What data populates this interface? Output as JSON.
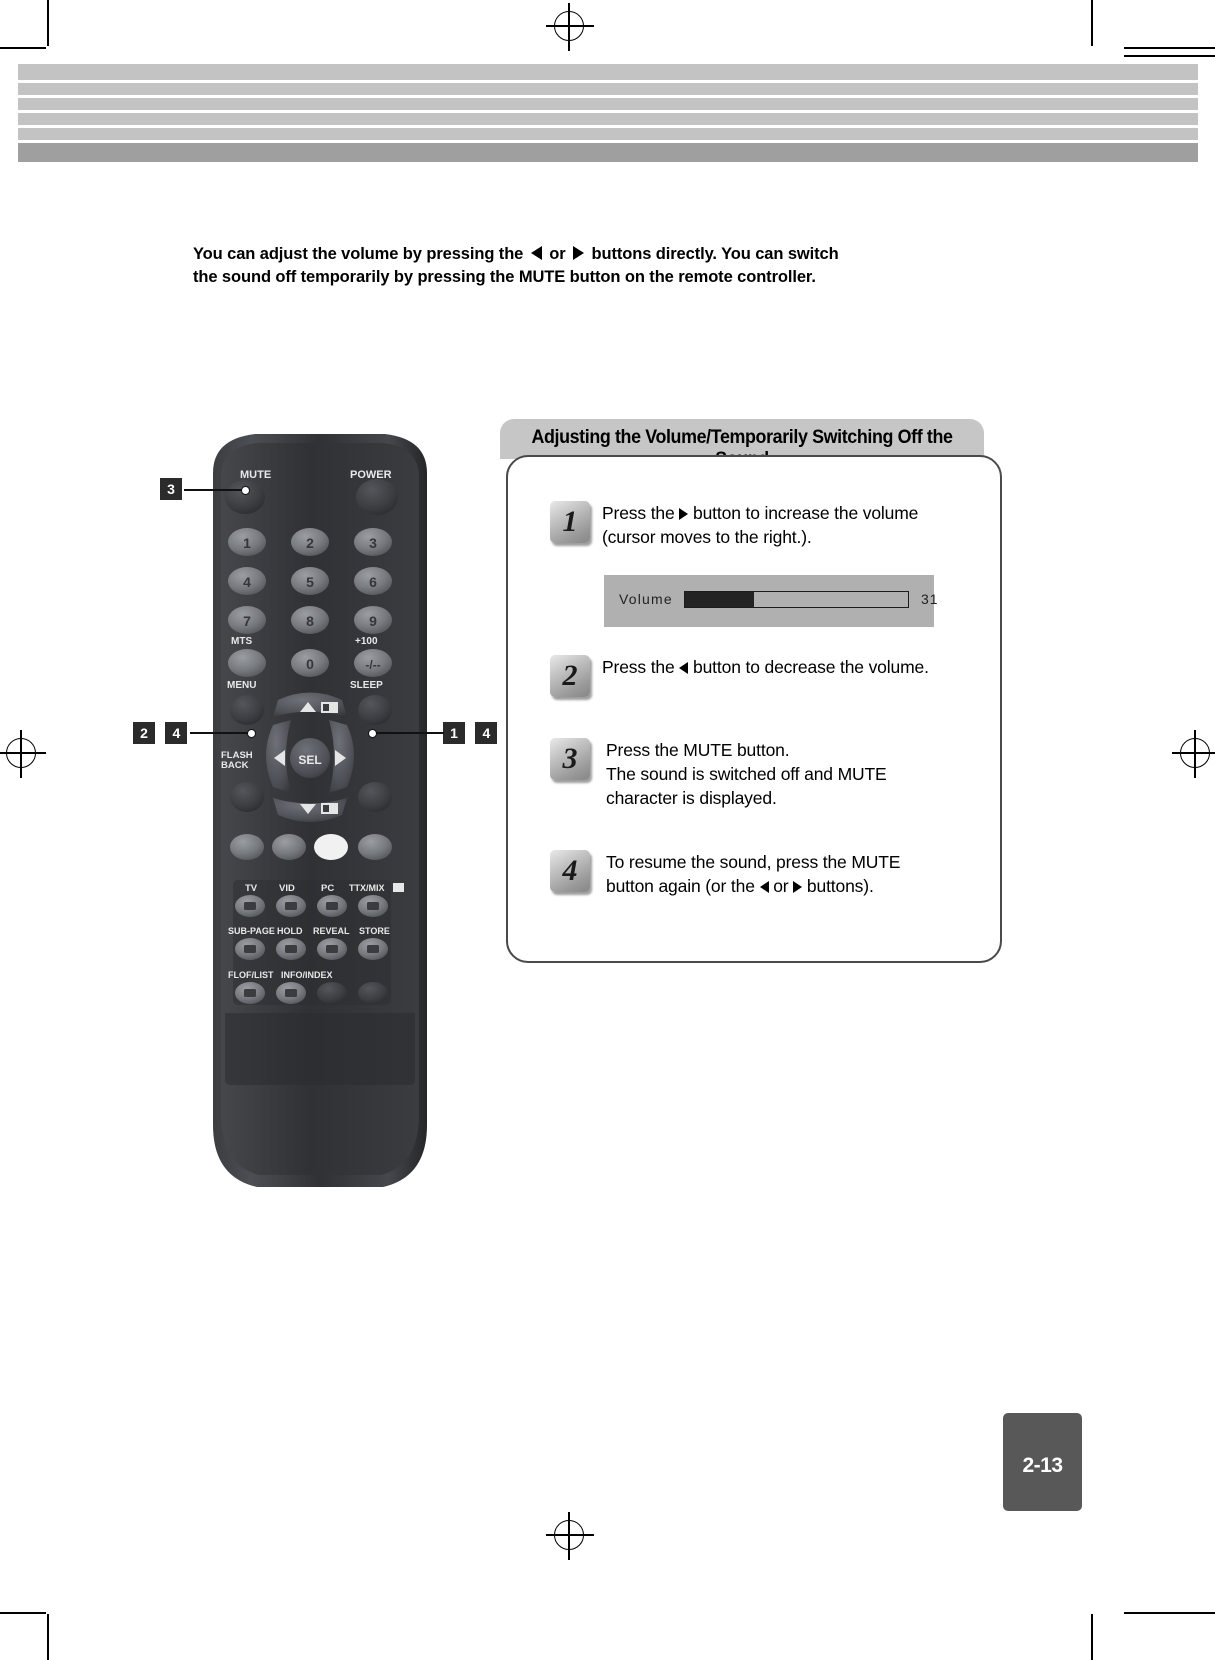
{
  "page": {
    "number": "2-13",
    "intro_line1_a": "You can adjust the volume by pressing the",
    "intro_line1_b": "or",
    "intro_line1_c": "buttons directly. You can switch",
    "intro_line2": "the sound off temporarily by pressing the MUTE button on the remote controller."
  },
  "panel": {
    "title": "Adjusting the Volume/Temporarily Switching Off the Sound",
    "steps": [
      {
        "number": "1",
        "text_a": "Press the",
        "icon": "triangle-right-icon",
        "text_b": "button to increase the volume",
        "line2": "(cursor moves to the right.)."
      },
      {
        "number": "2",
        "text_a": "Press the",
        "icon": "triangle-left-icon",
        "text_b": "button to decrease the volume."
      },
      {
        "number": "3",
        "line1": "Press the MUTE button.",
        "line2": "The sound is switched off and MUTE",
        "line3": "character is displayed."
      },
      {
        "number": "4",
        "line1": "To resume the sound, press the MUTE",
        "line2_a": "button again (or the",
        "icon1": "triangle-left-icon",
        "line2_b": "or",
        "icon2": "triangle-right-icon",
        "line2_c": "buttons)."
      }
    ]
  },
  "osd": {
    "label": "Volume",
    "value": "31",
    "fill_percent": 31,
    "max": 100
  },
  "remote": {
    "top_labels": {
      "mute": "MUTE",
      "power": "POWER"
    },
    "keypad": [
      "1",
      "2",
      "3",
      "4",
      "5",
      "6",
      "7",
      "8",
      "9"
    ],
    "row_labels": {
      "mts": "MTS",
      "plus100": "+100",
      "zero": "0",
      "dash": "-/--"
    },
    "menu_label": "MENU",
    "sleep_label": "SLEEP",
    "sel_label": "SEL",
    "flashback_line1": "FLASH",
    "flashback_line2": "BACK",
    "source_labels": [
      "TV",
      "VID",
      "PC",
      "TTX/MIX"
    ],
    "teletext_row1": [
      "SUB-PAGE",
      "HOLD",
      "REVEAL",
      "STORE"
    ],
    "teletext_row2": [
      "FLOF/LIST",
      "INFO/INDEX"
    ]
  },
  "callouts": [
    {
      "id": "mute",
      "tags": [
        "3"
      ],
      "target": "mute-button"
    },
    {
      "id": "left",
      "tags": [
        "2",
        "4"
      ],
      "target": "left-arrow-button"
    },
    {
      "id": "right",
      "tags": [
        "1",
        "4"
      ],
      "target": "right-arrow-button"
    }
  ],
  "colors": {
    "band": "#c3c3c3",
    "panel_title_bg": "#c6c6c6",
    "panel_border": "#4a4a4a",
    "osd_bg": "#b0b0b0",
    "osd_fill": "#232323",
    "page_tab_bg": "#585858",
    "remote_body": "#2f3033"
  }
}
